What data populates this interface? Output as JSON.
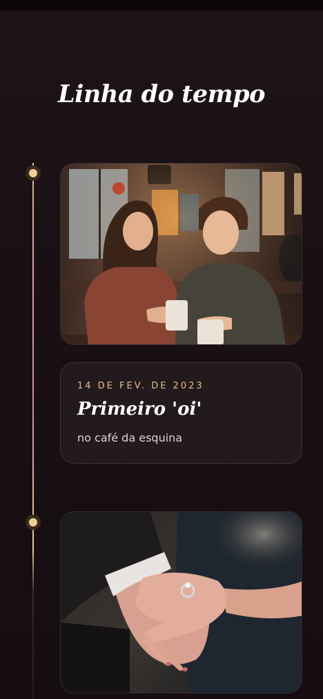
{
  "page": {
    "title": "Linha do tempo"
  },
  "timeline": {
    "events": [
      {
        "date": "14 DE FEV. DE 2023",
        "title": "Primeiro 'oi'",
        "description": "no café da esquina",
        "photo": "couple-at-cafe-photo"
      },
      {
        "photo": "hands-with-engagement-ring-photo"
      }
    ]
  },
  "colors": {
    "background": "#1a1014",
    "accent": "#e5bd8a",
    "card": "#231a1e",
    "dot": "#f0cf9a"
  }
}
